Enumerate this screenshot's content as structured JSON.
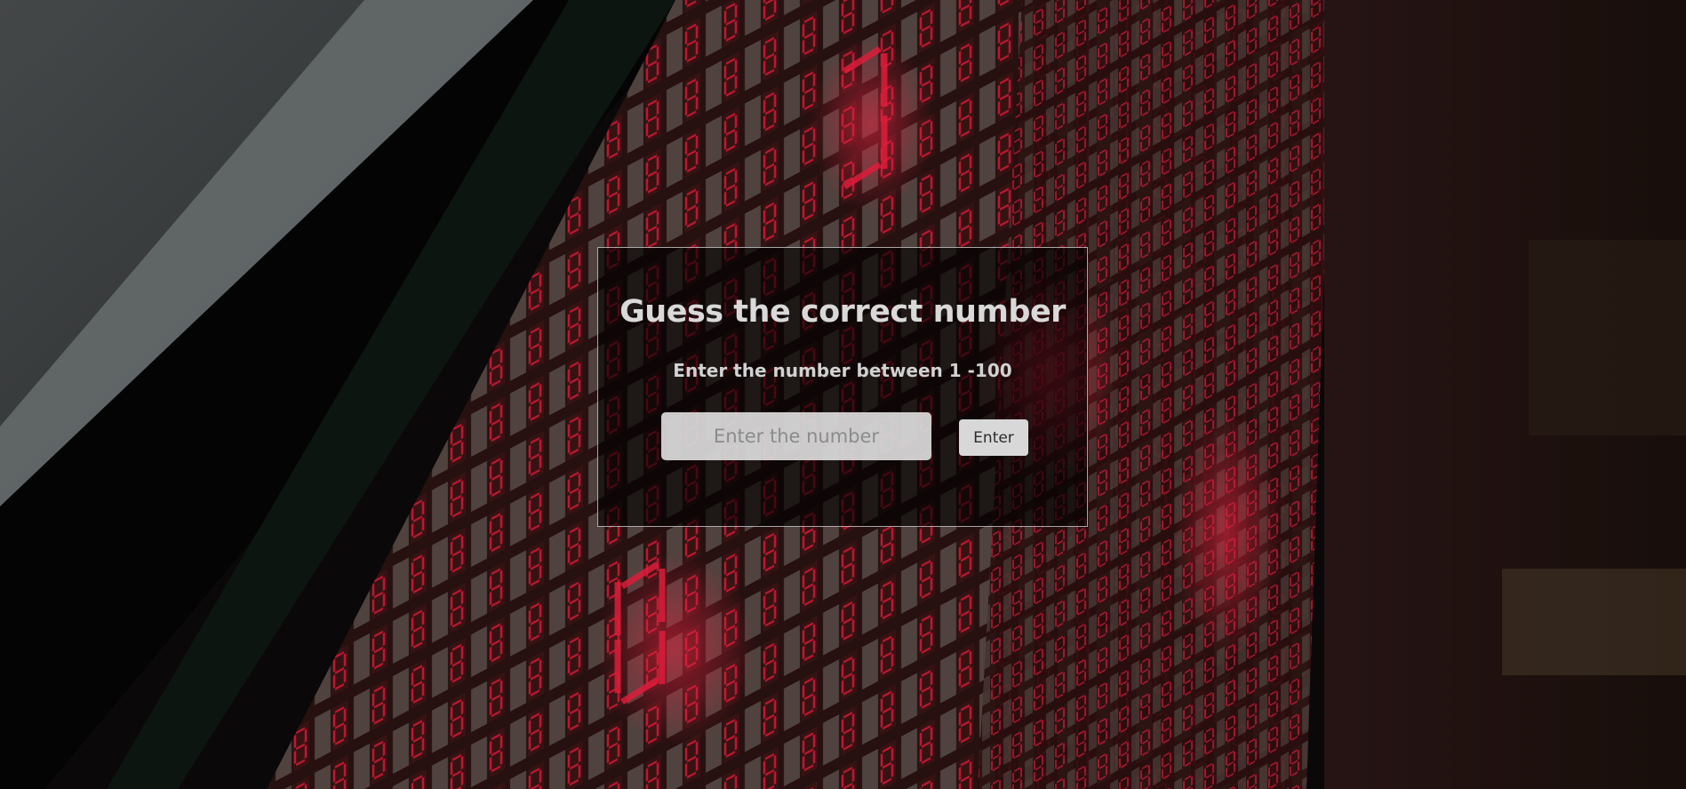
{
  "game": {
    "title": "Guess the correct number",
    "instruction": "Enter the number between 1 -100",
    "input": {
      "placeholder": "Enter the number",
      "value": ""
    },
    "enter_button_label": "Enter"
  },
  "colors": {
    "card_border": "#dcdcdc",
    "title_text": "#d9d9d9",
    "button_bg": "#d8d8d8",
    "led_red": "#e0193a"
  },
  "background": {
    "description_icon": "seven-segment-display-wall-photo"
  }
}
